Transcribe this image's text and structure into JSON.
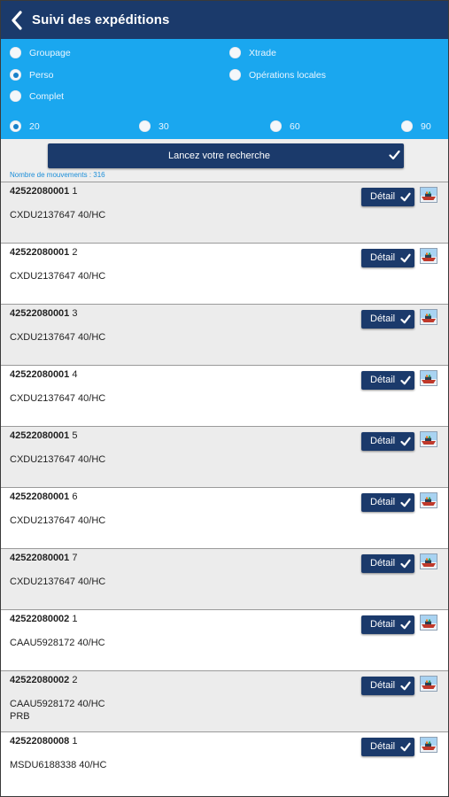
{
  "header": {
    "title": "Suivi des expéditions"
  },
  "filters": {
    "types": [
      {
        "label": "Groupage",
        "selected": false
      },
      {
        "label": "Xtrade",
        "selected": false
      },
      {
        "label": "Perso",
        "selected": true
      },
      {
        "label": "Opérations locales",
        "selected": false
      },
      {
        "label": "Complet",
        "selected": false
      }
    ],
    "periods": [
      {
        "label": "20",
        "selected": true
      },
      {
        "label": "30",
        "selected": false
      },
      {
        "label": "60",
        "selected": false
      },
      {
        "label": "90",
        "selected": false
      }
    ]
  },
  "search": {
    "button_label": "Lancez votre recherche",
    "count_text": "Nombre de mouvements : 316"
  },
  "detail_label": "Détail",
  "colors": {
    "header": "#1b3a6b",
    "filters_bg": "#1aa7ef",
    "button": "#1b3a6b",
    "count": "#1a8ed9"
  },
  "rows": [
    {
      "ref": "42522080001",
      "num": "1",
      "container": "CXDU2137647  40/HC",
      "extra": ""
    },
    {
      "ref": "42522080001",
      "num": "2",
      "container": "CXDU2137647  40/HC",
      "extra": ""
    },
    {
      "ref": "42522080001",
      "num": "3",
      "container": "CXDU2137647  40/HC",
      "extra": ""
    },
    {
      "ref": "42522080001",
      "num": "4",
      "container": "CXDU2137647  40/HC",
      "extra": ""
    },
    {
      "ref": "42522080001",
      "num": "5",
      "container": "CXDU2137647  40/HC",
      "extra": ""
    },
    {
      "ref": "42522080001",
      "num": "6",
      "container": "CXDU2137647  40/HC",
      "extra": ""
    },
    {
      "ref": "42522080001",
      "num": "7",
      "container": "CXDU2137647  40/HC",
      "extra": ""
    },
    {
      "ref": "42522080002",
      "num": "1",
      "container": "CAAU5928172  40/HC",
      "extra": ""
    },
    {
      "ref": "42522080002",
      "num": "2",
      "container": "CAAU5928172  40/HC",
      "extra": "PRB"
    },
    {
      "ref": "42522080008",
      "num": "1",
      "container": "MSDU6188338  40/HC",
      "extra": ""
    }
  ]
}
